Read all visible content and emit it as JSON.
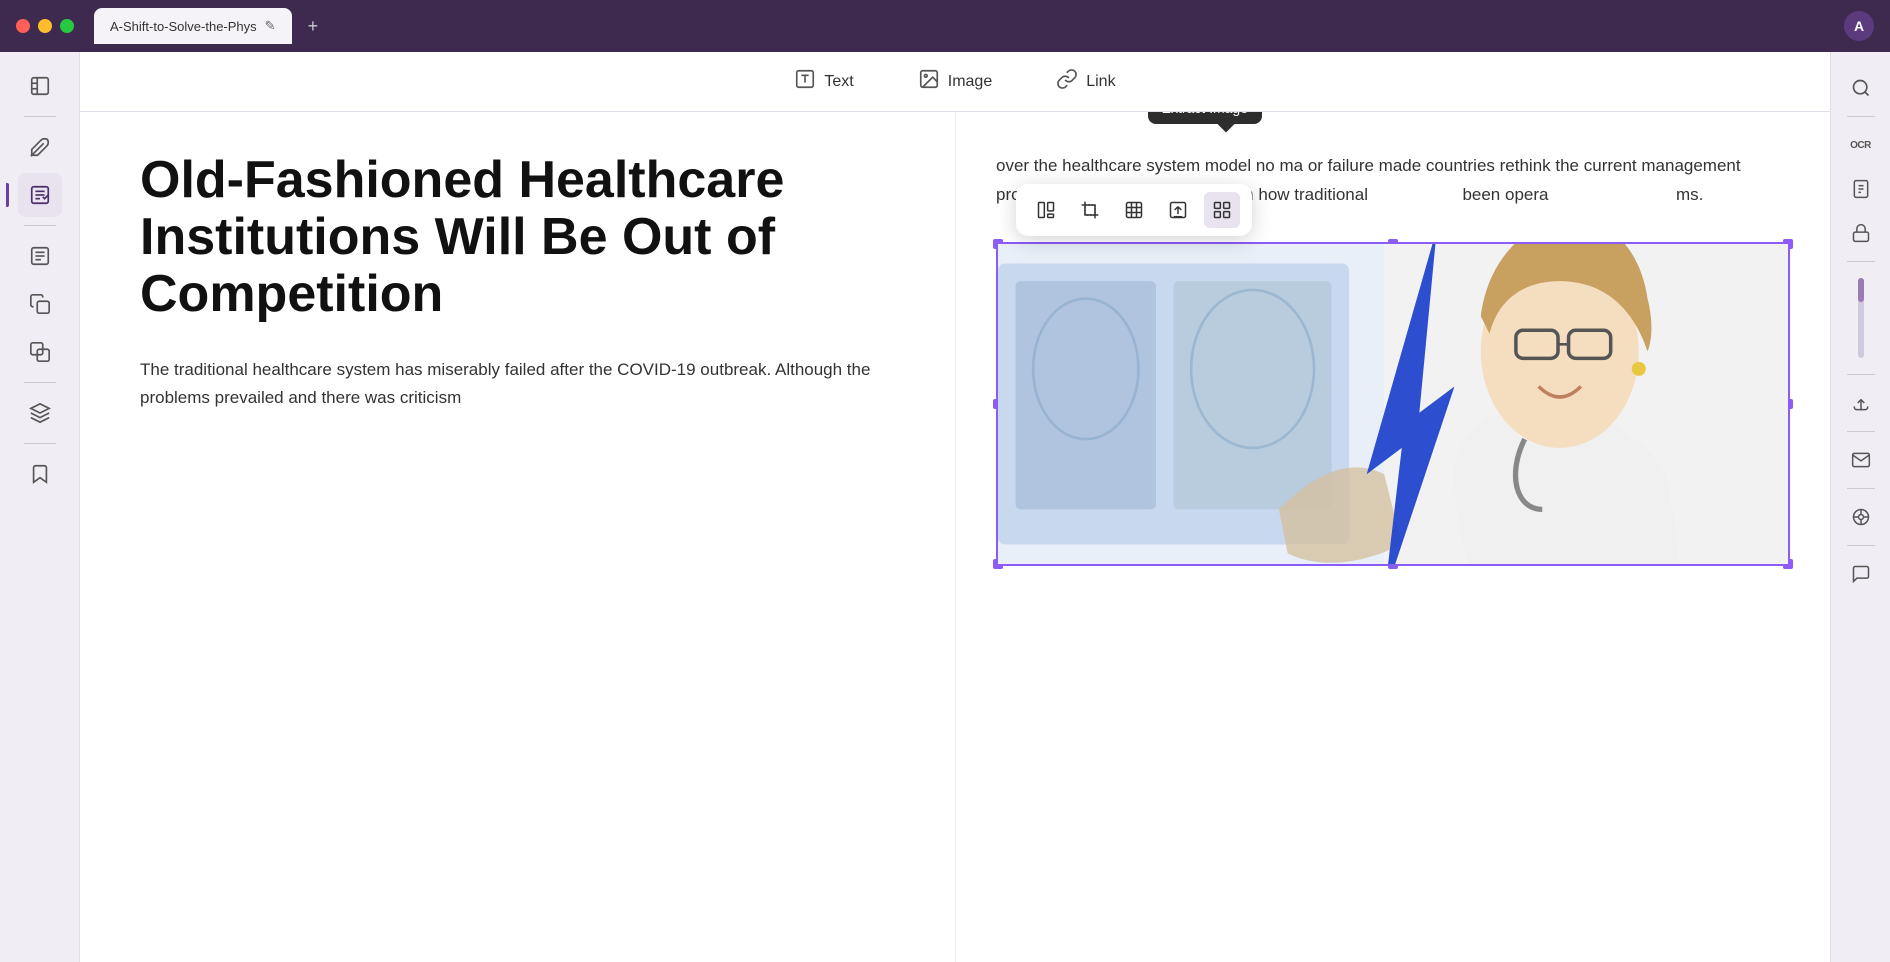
{
  "titleBar": {
    "tabTitle": "A-Shift-to-Solve-the-Phys",
    "editIcon": "✎",
    "addTabLabel": "+",
    "avatarInitial": "A"
  },
  "toolbar": {
    "textLabel": "Text",
    "imageLabel": "Image",
    "linkLabel": "Link"
  },
  "leftPage": {
    "heading": "Old-Fashioned Healthcare Institutions Will Be Out of Competition",
    "bodyText": "The traditional healthcare system has miserably failed after the COVID-19 outbreak. Although the problems prevailed and there was criticism"
  },
  "rightPage": {
    "bodyText": "over the healthcare system model no ma or failure made countries rethink the current management procedures. This part will focus on how traditional                     been opera                              ms.",
    "imageAlt": "Doctor holding X-ray"
  },
  "floatingToolbar": {
    "buttons": [
      {
        "icon": "⊞",
        "label": "layout",
        "tooltip": ""
      },
      {
        "icon": "⊡",
        "label": "crop",
        "tooltip": ""
      },
      {
        "icon": "⊠",
        "label": "trim",
        "tooltip": ""
      },
      {
        "icon": "⊟",
        "label": "export",
        "tooltip": ""
      },
      {
        "icon": "⊞",
        "label": "extract",
        "tooltip": "Extract Image"
      }
    ],
    "tooltip": "Extract Image"
  },
  "leftSidebar": {
    "icons": [
      {
        "name": "book-icon",
        "symbol": "📋",
        "active": false
      },
      {
        "name": "brush-icon",
        "symbol": "🖌",
        "active": false
      },
      {
        "name": "edit-doc-icon",
        "symbol": "📝",
        "active": true
      },
      {
        "name": "list-icon",
        "symbol": "📄",
        "active": false
      },
      {
        "name": "copy-icon",
        "symbol": "⧉",
        "active": false
      },
      {
        "name": "stack-icon",
        "symbol": "⊕",
        "active": false
      },
      {
        "name": "layers-icon",
        "symbol": "◫",
        "active": false
      },
      {
        "name": "bookmark-icon",
        "symbol": "🔖",
        "active": false
      }
    ]
  },
  "rightSidebar": {
    "icons": [
      {
        "name": "search-icon",
        "symbol": "🔍"
      },
      {
        "name": "ocr-icon",
        "symbol": "OCR"
      },
      {
        "name": "extract-icon",
        "symbol": "📤"
      },
      {
        "name": "lock-icon",
        "symbol": "🔒"
      },
      {
        "name": "file-icon",
        "symbol": "📄"
      },
      {
        "name": "share-icon",
        "symbol": "↑"
      },
      {
        "name": "mail-icon",
        "symbol": "✉"
      },
      {
        "name": "save-icon",
        "symbol": "💾"
      },
      {
        "name": "chat-icon",
        "symbol": "💬"
      }
    ]
  },
  "colors": {
    "accent": "#6b3fa0",
    "titlebarBg": "#3d2a4e",
    "selectionBorder": "#8b5cf6",
    "tooltipBg": "#2d2d2d",
    "arrowBlue": "#2244cc"
  }
}
